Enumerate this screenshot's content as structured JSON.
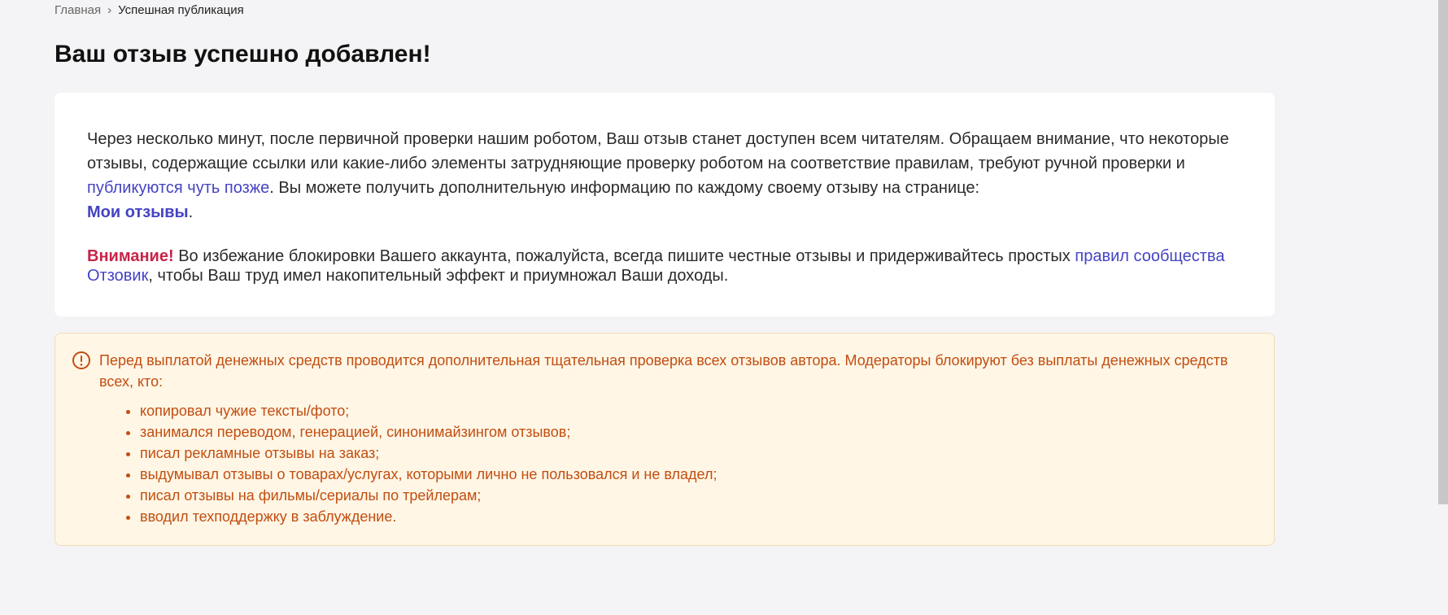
{
  "breadcrumb": {
    "home": "Главная",
    "separator": "›",
    "current": "Успешная публикация"
  },
  "page_title": "Ваш отзыв успешно добавлен!",
  "card": {
    "para1_part1": "Через несколько минут, после первичной проверки нашим роботом, Ваш отзыв станет доступен всем читателям. Обращаем внимание, что некоторые отзывы, содержащие ссылки или какие-либо элементы затрудняющие проверку роботом на соответствие правилам, требуют ручной проверки и ",
    "link_later": "публикуются чуть позже",
    "para1_part2": ". Вы можете получить дополнительную информацию по каждому своему отзыву на странице: ",
    "link_my_reviews": "Мои отзывы",
    "para1_end": ".",
    "attention_word": "Внимание!",
    "para2_part1": " Во избежание блокировки Вашего аккаунта, пожалуйста, всегда пишите честные отзывы и придерживайтесь простых ",
    "link_rules": "правил сообщества Отзовик",
    "para2_part2": ", чтобы Ваш труд имел накопительный эффект и приумножал Ваши доходы."
  },
  "notice": {
    "icon": "exclamation-circle-icon",
    "intro": "Перед выплатой денежных средств проводится дополнительная тщательная проверка всех отзывов автора. Модераторы блокируют без выплаты денежных средств всех, кто:",
    "items": [
      "копировал чужие тексты/фото;",
      "занимался переводом, генерацией, синонимайзингом отзывов;",
      "писал рекламные отзывы на заказ;",
      "выдумывал отзывы о товарах/услугах, которыми лично не пользовался и не владел;",
      "писал отзывы на фильмы/сериалы по трейлерам;",
      "вводил техподдержку в заблуждение."
    ]
  },
  "colors": {
    "background": "#f4f4f6",
    "link": "#4443c4",
    "attention": "#c8234a",
    "notice_text": "#c24e10",
    "notice_bg": "#fff6e6"
  }
}
